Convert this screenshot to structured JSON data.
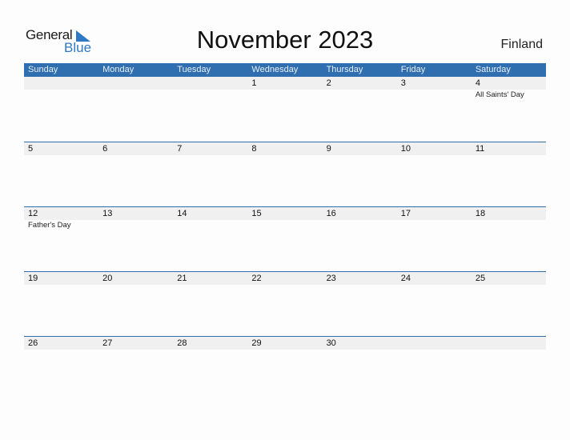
{
  "logo": {
    "general": "General",
    "blue": "Blue"
  },
  "title": "November 2023",
  "country": "Finland",
  "colors": {
    "accent": "#2f6fb0",
    "logo_blue": "#2f78c4",
    "date_strip": "#f0f0f0"
  },
  "weekdays": [
    "Sunday",
    "Monday",
    "Tuesday",
    "Wednesday",
    "Thursday",
    "Friday",
    "Saturday"
  ],
  "weeks": [
    [
      {
        "d": ""
      },
      {
        "d": ""
      },
      {
        "d": ""
      },
      {
        "d": "1"
      },
      {
        "d": "2"
      },
      {
        "d": "3"
      },
      {
        "d": "4",
        "ev": "All Saints' Day"
      }
    ],
    [
      {
        "d": "5"
      },
      {
        "d": "6"
      },
      {
        "d": "7"
      },
      {
        "d": "8"
      },
      {
        "d": "9"
      },
      {
        "d": "10"
      },
      {
        "d": "11"
      }
    ],
    [
      {
        "d": "12",
        "ev": "Father's Day"
      },
      {
        "d": "13"
      },
      {
        "d": "14"
      },
      {
        "d": "15"
      },
      {
        "d": "16"
      },
      {
        "d": "17"
      },
      {
        "d": "18"
      }
    ],
    [
      {
        "d": "19"
      },
      {
        "d": "20"
      },
      {
        "d": "21"
      },
      {
        "d": "22"
      },
      {
        "d": "23"
      },
      {
        "d": "24"
      },
      {
        "d": "25"
      }
    ],
    [
      {
        "d": "26"
      },
      {
        "d": "27"
      },
      {
        "d": "28"
      },
      {
        "d": "29"
      },
      {
        "d": "30"
      },
      {
        "d": ""
      },
      {
        "d": ""
      }
    ]
  ]
}
